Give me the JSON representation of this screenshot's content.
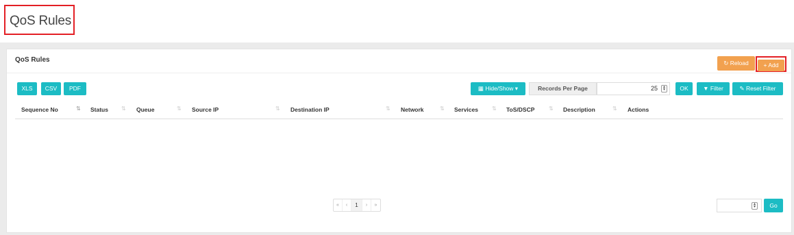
{
  "header": {
    "title": "QoS Rules"
  },
  "panel": {
    "title": "QoS Rules",
    "reload_label": "↻ Reload",
    "add_label": "+ Add"
  },
  "export": {
    "xls": "XLS",
    "csv": "CSV",
    "pdf": "PDF"
  },
  "toolbar": {
    "hide_show_label": "▦ Hide/Show ▾",
    "records_per_page_label": "Records Per Page",
    "records_per_page_value": "25",
    "ok_label": "OK",
    "filter_label": "▼ Filter",
    "reset_filter_label": "✎ Reset Filter"
  },
  "table": {
    "columns": [
      "Sequence No",
      "Status",
      "Queue",
      "Source IP",
      "Destination IP",
      "Network",
      "Services",
      "ToS/DSCP",
      "Description",
      "Actions"
    ],
    "rows": []
  },
  "pagination": {
    "first": "«",
    "prev": "‹",
    "current": "1",
    "next": "›",
    "last": "»",
    "go_label": "Go"
  },
  "colors": {
    "accent_teal": "#1cbcc4",
    "accent_orange": "#f2a14f",
    "highlight_red": "#e31e24"
  }
}
